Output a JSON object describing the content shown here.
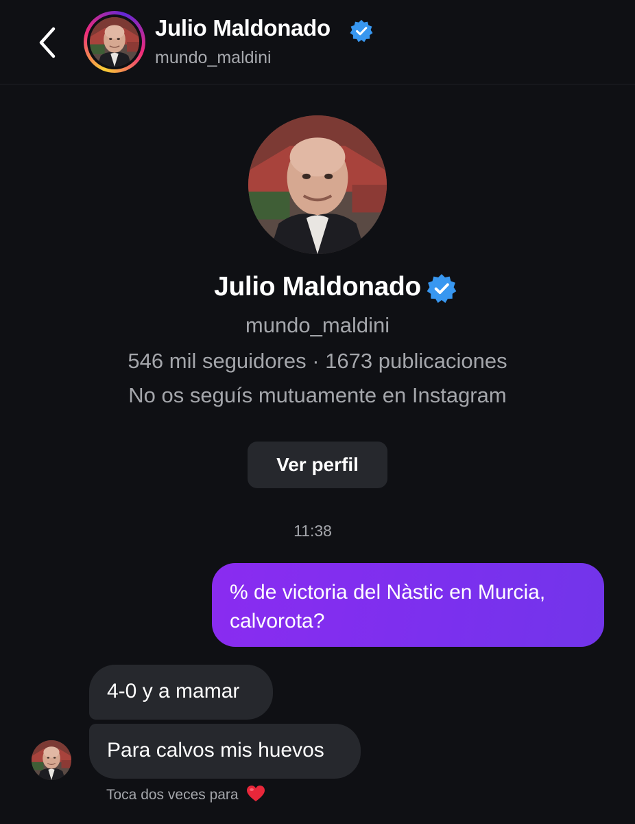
{
  "header": {
    "name": "Julio Maldonado",
    "username": "mundo_maldini",
    "back_icon": "chevron-left-icon",
    "verified_icon": "verified-badge-icon",
    "story_ring_colors": [
      "#f9ce34",
      "#ee2a7b",
      "#6228d7"
    ]
  },
  "profile": {
    "name": "Julio Maldonado",
    "username": "mundo_maldini",
    "stats": "546 mil seguidores · 1673 publicaciones",
    "mutual": "No os seguís mutuamente en Instagram",
    "view_profile_label": "Ver perfil",
    "verified_color": "#3897f0"
  },
  "chat": {
    "timestamp": "11:38",
    "messages": [
      {
        "from": "me",
        "text": "% de victoria del Nàstic en Murcia, calvorota?"
      },
      {
        "from": "them",
        "text": "4-0 y a mamar"
      },
      {
        "from": "them",
        "text": "Para calvos mis huevos"
      }
    ],
    "double_tap_hint": "Toca dos veces para",
    "hint_icon": "heart-icon",
    "outgoing_bubble_color": "#7b30ee",
    "incoming_bubble_color": "#26282d"
  }
}
